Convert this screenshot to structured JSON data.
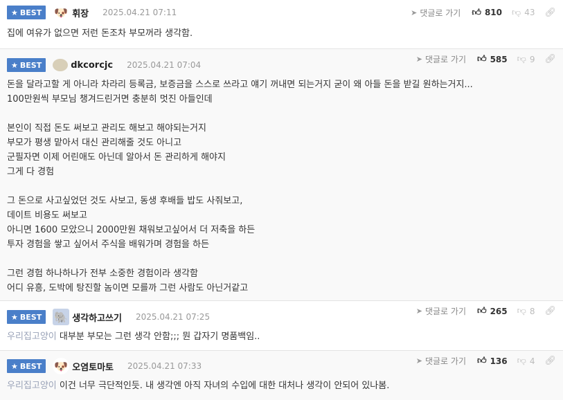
{
  "badge_label": "BEST",
  "reply_label": "댓글로 가기",
  "comments": [
    {
      "nick": "휘장",
      "date": "2025.04.21 07:11",
      "up": "810",
      "down": "43",
      "quote": "",
      "text": "집에 여유가 없으면 저런 돈조차 부모꺼라 생각함."
    },
    {
      "nick": "dkcorcjc",
      "date": "2025.04.21 07:04",
      "up": "585",
      "down": "9",
      "quote": "",
      "text": "돈을 달라고할 게 아니라 차라리 등록금, 보증금을 스스로 쓰라고 얘기 꺼내면 되는거지 굳이 왜 아들 돈을 받길 원하는거지...\n100만원씩 부모님 챙겨드린거면 충분히 멋진 아들인데\n\n본인이 직접 돈도 써보고 관리도 해보고 해야되는거지\n부모가 평생 맡아서 대신 관리해줄 것도 아니고\n군필자면 이제 어린애도 아닌데 알아서 돈 관리하게 해야지\n그게 다 경험\n\n그 돈으로 사고싶었던 것도 사보고, 동생 후배들 밥도 사줘보고,\n데이트 비용도 써보고\n아니면 1600 모았으니 2000만원 채워보고싶어서 더 저축을 하든\n투자 경험을 쌓고 싶어서 주식을 배워가며 경험을 하든\n\n그런 경험 하나하나가 전부 소중한 경험이라 생각함\n어디 유흥, 도박에 탕진할 놈이면 모를까 그런 사람도 아닌거같고"
    },
    {
      "nick": "생각하고쓰기",
      "date": "2025.04.21 07:25",
      "up": "265",
      "down": "8",
      "quote": "우리집고양이",
      "text": " 대부분 부모는 그런 생각 안함;;; 뭔 갑자기 명품백임.."
    },
    {
      "nick": "오염토마토",
      "date": "2025.04.21 07:33",
      "up": "136",
      "down": "4",
      "quote": "우리집고양이",
      "text": " 이건 너무 극단적인듯. 내 생각엔 아직 자녀의 수입에 대한 대처나 생각이 안되어 있나봄."
    }
  ]
}
